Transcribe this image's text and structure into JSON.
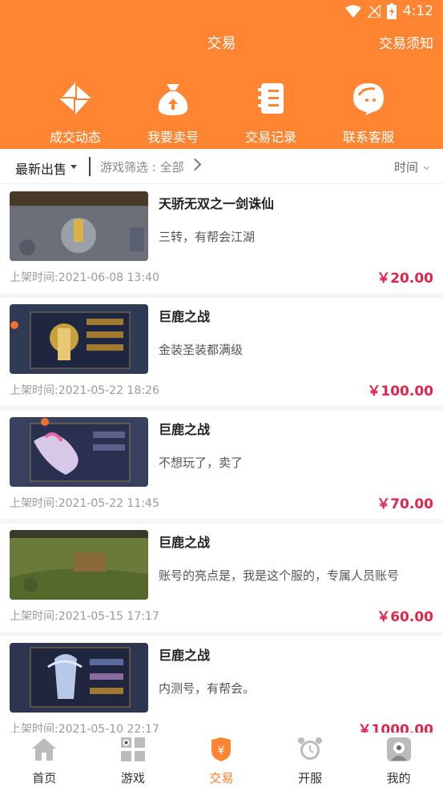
{
  "status_bar": {
    "time": "4:12",
    "wifi_icon": "wifi-icon",
    "signal_icon": "no-signal-icon",
    "battery_icon": "battery-charging-icon"
  },
  "header": {
    "title": "交易",
    "notice": "交易须知",
    "quick_actions": [
      {
        "label": "成交动态",
        "icon": "pinwheel-icon"
      },
      {
        "label": "我要卖号",
        "icon": "money-bag-icon"
      },
      {
        "label": "交易记录",
        "icon": "record-icon"
      },
      {
        "label": "联系客服",
        "icon": "customer-service-icon"
      }
    ]
  },
  "filter": {
    "sort_label": "最新出售",
    "game_filter": "游戏筛选 : 全部",
    "time_label": "时间"
  },
  "listings": [
    {
      "title": "天骄无双之一剑诛仙",
      "desc": "三转，有帮会江湖",
      "date": "上架时间:2021-06-08 13:40",
      "price": "￥20.00",
      "thumb_color": "#6b6f78"
    },
    {
      "title": "巨鹿之战",
      "desc": "金装圣装都满级",
      "date": "上架时间:2021-05-22 18:26",
      "price": "￥100.00",
      "thumb_color": "#2f3a55"
    },
    {
      "title": "巨鹿之战",
      "desc": "不想玩了，卖了",
      "date": "上架时间:2021-05-22 11:45",
      "price": "￥70.00",
      "thumb_color": "#3a4060"
    },
    {
      "title": "巨鹿之战",
      "desc": "账号的亮点是，我是这个服的，专属人员账号",
      "date": "上架时间:2021-05-15 17:17",
      "price": "￥60.00",
      "thumb_color": "#6a7a3a"
    },
    {
      "title": "巨鹿之战",
      "desc": "内测号，有帮会。",
      "date": "上架时间:2021-05-10 22:17",
      "price": "￥1000.00",
      "thumb_color": "#2e3550"
    }
  ],
  "tabs": [
    {
      "label": "首页",
      "icon": "home-icon",
      "active": false
    },
    {
      "label": "游戏",
      "icon": "grid-icon",
      "active": false
    },
    {
      "label": "交易",
      "icon": "yen-shield-icon",
      "active": true
    },
    {
      "label": "开服",
      "icon": "alarm-clock-icon",
      "active": false
    },
    {
      "label": "我的",
      "icon": "avatar-icon",
      "active": false
    }
  ],
  "colors": {
    "accent": "#ff8533",
    "price": "#e1254a"
  }
}
